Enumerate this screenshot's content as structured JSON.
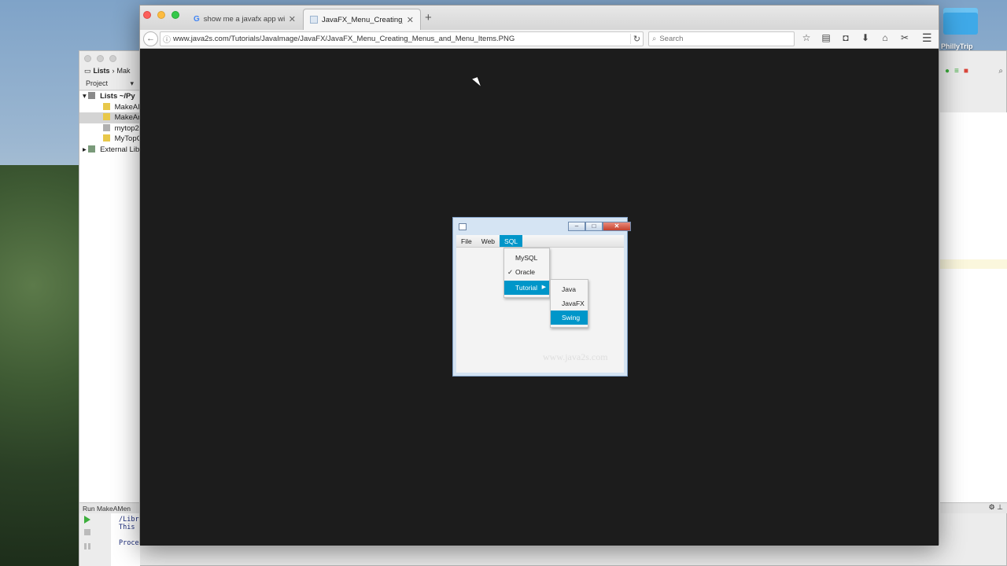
{
  "desktop": {
    "folder_label": "PhillyTrip"
  },
  "ide": {
    "breadcrumb": [
      "Lists",
      "Mak"
    ],
    "project_label": "Project",
    "tree": [
      {
        "label": "Lists  ~/Py",
        "expanded": true
      },
      {
        "label": "MakeAM",
        "selected": false
      },
      {
        "label": "MakeAn",
        "selected": true
      },
      {
        "label": "mytop2",
        "selected": false
      },
      {
        "label": "MyTopC",
        "selected": false
      },
      {
        "label": "External Lib",
        "expanded": false
      }
    ],
    "run_bar_label": "Run",
    "run_config": "MakeAMen",
    "console_lines": [
      "/Libra",
      "This",
      "",
      "Process"
    ]
  },
  "browser": {
    "tabs": [
      {
        "title": "show me a javafx app with a",
        "active": false
      },
      {
        "title": "JavaFX_Menu_Creating_Menu",
        "active": true
      }
    ],
    "new_tab_symbol": "+",
    "url": "www.java2s.com/Tutorials/JavaImage/JavaFX/JavaFX_Menu_Creating_Menus_and_Menu_Items.PNG",
    "search_placeholder": "Search",
    "toolbar_icons": [
      "star-icon",
      "reading-list-icon",
      "pocket-icon",
      "download-icon",
      "home-icon",
      "screenshot-icon"
    ]
  },
  "fx_demo": {
    "menus": [
      "File",
      "Web",
      "SQL"
    ],
    "active_menu": "SQL",
    "sql_items": [
      {
        "label": "MySQL",
        "checked": false
      },
      {
        "label": "Oracle",
        "checked": true
      },
      {
        "label": "Tutorial",
        "submenu": true
      }
    ],
    "tutorial_items": [
      "Java",
      "JavaFX",
      "Swing"
    ],
    "highlighted_item": "Swing",
    "watermark": "www.java2s.com",
    "accent_color": "#0096c9"
  }
}
